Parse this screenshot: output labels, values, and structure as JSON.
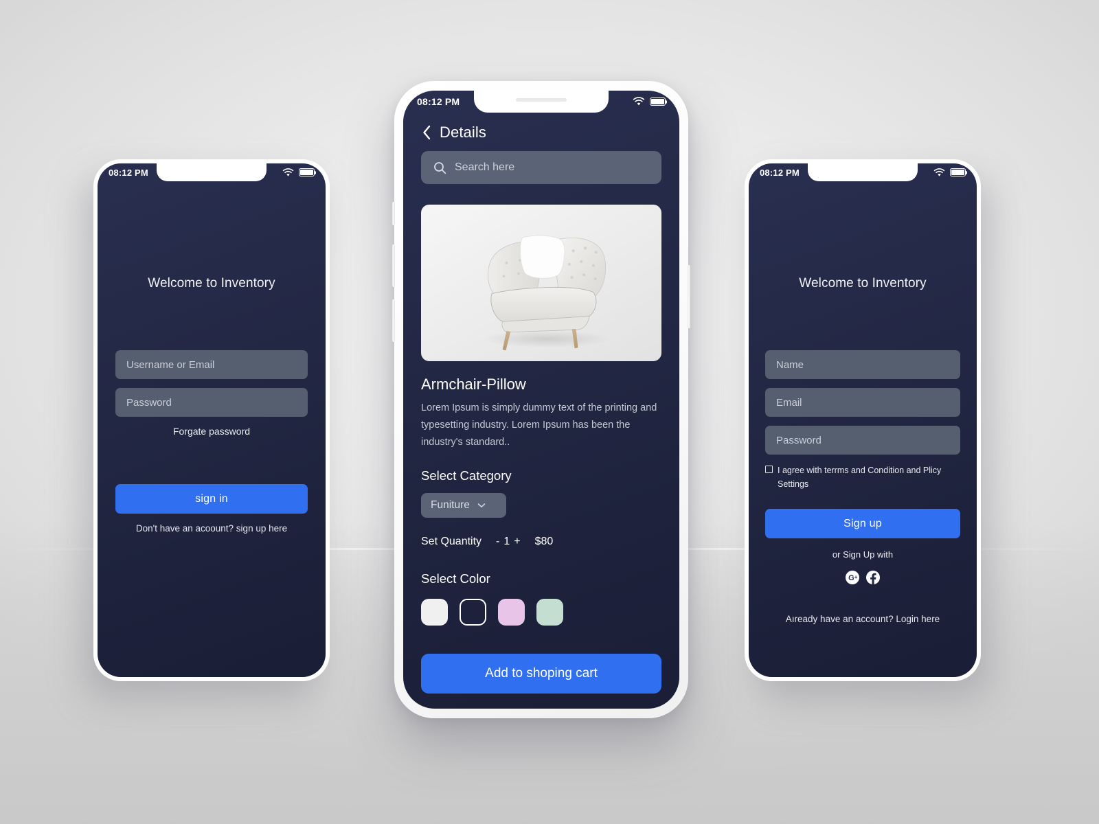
{
  "theme": {
    "screen_bg": "#232845",
    "field_bg": "#555f70",
    "accent_blue": "#2f6ff0",
    "text_primary": "#ffffff",
    "text_muted": "#c4c9d4",
    "page_bg": "#eaeaea"
  },
  "status_bar": {
    "time": "08:12 PM",
    "wifi_icon": "wifi-icon",
    "battery_icon": "battery-icon"
  },
  "login_screen": {
    "title": "Welcome to Inventory",
    "username_placeholder": "Username or Email",
    "password_placeholder": "Password",
    "forgot_label": "Forgate password",
    "signin_label": "sign in",
    "signup_prompt": "Don't have an acoount? sign up here"
  },
  "details_screen": {
    "back_icon": "chevron-left-icon",
    "title": "Details",
    "search_icon": "search-icon",
    "search_placeholder": "Search here",
    "product_image_alt": "white tufted armchair with pillow",
    "product_name": "Armchair-Pillow",
    "product_description": "Lorem Ipsum is simply dummy text of the printing and typesetting industry. Lorem Ipsum has been the industry's standard..",
    "category_label": "Select  Category",
    "category_value": "Funiture",
    "category_chevron_icon": "chevron-down-icon",
    "quantity_label": "Set Quantity",
    "quantity_minus": "-",
    "quantity_value": "1",
    "quantity_plus": "+",
    "price": "$80",
    "color_label": "Select  Color",
    "colors": [
      {
        "name": "white",
        "hex": "#f0f0f0",
        "selected": false
      },
      {
        "name": "black",
        "hex": "#232845",
        "selected": true
      },
      {
        "name": "pink",
        "hex": "#e8c5e8",
        "selected": false
      },
      {
        "name": "mint",
        "hex": "#c5ded2",
        "selected": false
      }
    ],
    "add_to_cart_label": "Add to shoping cart"
  },
  "signup_screen": {
    "title": "Welcome to Inventory",
    "name_placeholder": "Name",
    "email_placeholder": "Email",
    "password_placeholder": "Password",
    "terms_text": "I agree with terrms and Condition and Plicy Settings",
    "signup_label": "Sign up",
    "or_label": "or Sign Up with",
    "socials": [
      {
        "name": "google-plus-icon"
      },
      {
        "name": "facebook-icon"
      }
    ],
    "login_prompt": "Aıready have an account? Login here"
  }
}
